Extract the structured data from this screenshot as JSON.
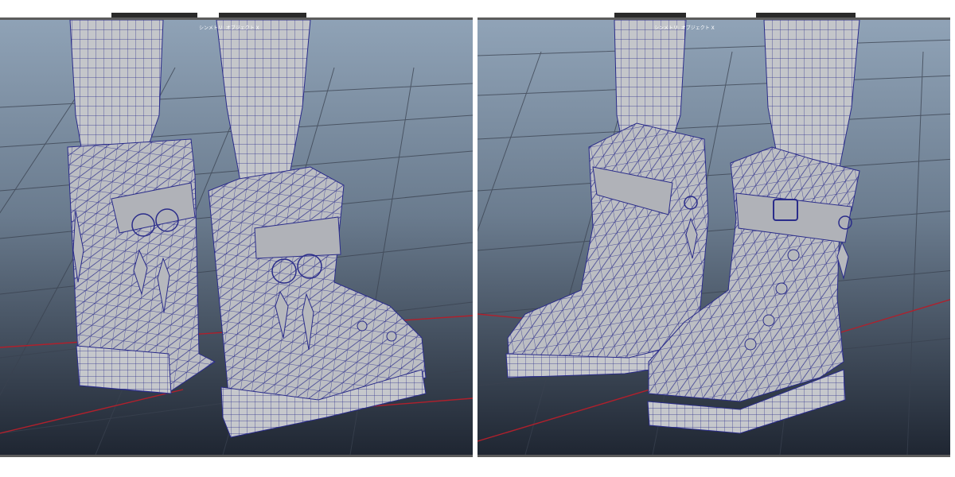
{
  "viewports": [
    {
      "id": "left",
      "title": "シンメトリ: オブジェクト X",
      "view": "back-three-quarter"
    },
    {
      "id": "right",
      "title": "シンメトリ: オブジェクト X",
      "view": "front-three-quarter"
    }
  ],
  "colors": {
    "background_top": "#8fa2b6",
    "background_bottom": "#1f2632",
    "grid": "#3a4250",
    "grid_axis": "#b0202c",
    "mesh_fill": "#b9bbc0",
    "wire": "#2a2c8a",
    "frame": "#5c5c5c"
  },
  "objects": [
    "boot-left",
    "boot-right",
    "leg-left",
    "leg-right"
  ]
}
